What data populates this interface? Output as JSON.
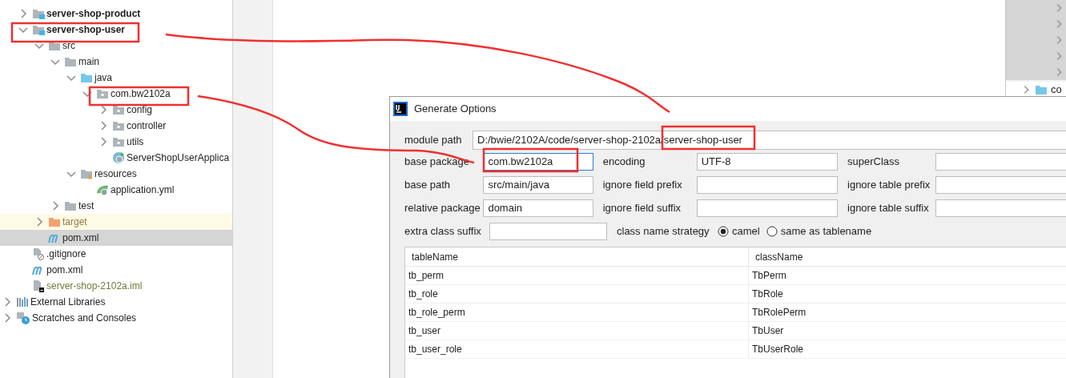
{
  "project_tree": {
    "modules": [
      {
        "label": "server-shop-product",
        "kind": "module",
        "expanded": false,
        "selected": false
      },
      {
        "label": "server-shop-user",
        "kind": "module",
        "expanded": true,
        "selected": false,
        "children": [
          {
            "label": "src",
            "kind": "folder",
            "expanded": true,
            "selected": false,
            "children": [
              {
                "label": "main",
                "kind": "folder",
                "expanded": true,
                "selected": false,
                "children": [
                  {
                    "label": "java",
                    "kind": "source-folder",
                    "expanded": true,
                    "selected": false,
                    "children": [
                      {
                        "label": "com.bw2102a",
                        "kind": "package",
                        "expanded": true,
                        "selected": false,
                        "children": [
                          {
                            "label": "config",
                            "kind": "package",
                            "expanded": false,
                            "selected": false
                          },
                          {
                            "label": "controller",
                            "kind": "package",
                            "expanded": false,
                            "selected": false
                          },
                          {
                            "label": "utils",
                            "kind": "package",
                            "expanded": false,
                            "selected": false
                          },
                          {
                            "label": "ServerShopUserApplica",
                            "kind": "class",
                            "selected": false
                          }
                        ]
                      }
                    ]
                  },
                  {
                    "label": "resources",
                    "kind": "resources",
                    "expanded": true,
                    "selected": false,
                    "children": [
                      {
                        "label": "application.yml",
                        "kind": "yaml",
                        "selected": false
                      }
                    ]
                  }
                ]
              },
              {
                "label": "test",
                "kind": "folder",
                "expanded": false,
                "selected": false
              }
            ]
          },
          {
            "label": "target",
            "kind": "excluded",
            "expanded": false,
            "selected": false
          },
          {
            "label": "pom.xml",
            "kind": "maven",
            "selected": true
          }
        ]
      },
      {
        "label": ".gitignore",
        "kind": "gitignore",
        "selected": false
      },
      {
        "label": "pom.xml",
        "kind": "maven",
        "selected": false
      },
      {
        "label": "server-shop-2102a.iml",
        "kind": "iml",
        "selected": false
      }
    ],
    "root_items": [
      {
        "label": "External Libraries",
        "kind": "libraries",
        "expanded": false,
        "selected": false
      },
      {
        "label": "Scratches and Consoles",
        "kind": "scratches",
        "expanded": false,
        "selected": false
      }
    ]
  },
  "right_panel": {
    "items": [
      {
        "expanded": false
      },
      {
        "expanded": false
      },
      {
        "expanded": false
      },
      {
        "expanded": false
      },
      {
        "expanded": false
      },
      {
        "label": "co",
        "expanded": false
      }
    ]
  },
  "dialog": {
    "title": "Generate Options",
    "module_path": {
      "label": "module path",
      "value": "D:/bwie/2102A/code/server-shop-2102a/server-shop-user"
    },
    "rows": [
      [
        {
          "label": "base package",
          "value": "com.bw2102a",
          "focused": true
        },
        {
          "label": "encoding",
          "value": "UTF-8",
          "focused": false
        },
        {
          "label": "superClass",
          "focused": false
        }
      ],
      [
        {
          "label": "base path",
          "value": "src/main/java",
          "focused": false
        },
        {
          "label": "ignore field prefix",
          "focused": false
        },
        {
          "label": "ignore table prefix",
          "focused": false
        }
      ],
      [
        {
          "label": "relative package",
          "value": "domain",
          "focused": false
        },
        {
          "label": "ignore field suffix",
          "focused": false
        },
        {
          "label": "ignore table suffix",
          "focused": false
        }
      ]
    ],
    "extra_class_suffix": {
      "label": "extra class suffix",
      "focused": false
    },
    "class_name_strategy": {
      "label": "class name strategy",
      "options": [
        {
          "label": "camel",
          "selected": true
        },
        {
          "label": "same as tablename",
          "selected": false
        }
      ]
    },
    "table": {
      "columns": [
        "tableName",
        "className"
      ],
      "rows": [
        [
          "tb_perm",
          "TbPerm"
        ],
        [
          "tb_role",
          "TbRole"
        ],
        [
          "tb_role_perm",
          "TbRolePerm"
        ],
        [
          "tb_user",
          "TbUser"
        ],
        [
          "tb_user_role",
          "TbUserRole"
        ]
      ]
    }
  }
}
